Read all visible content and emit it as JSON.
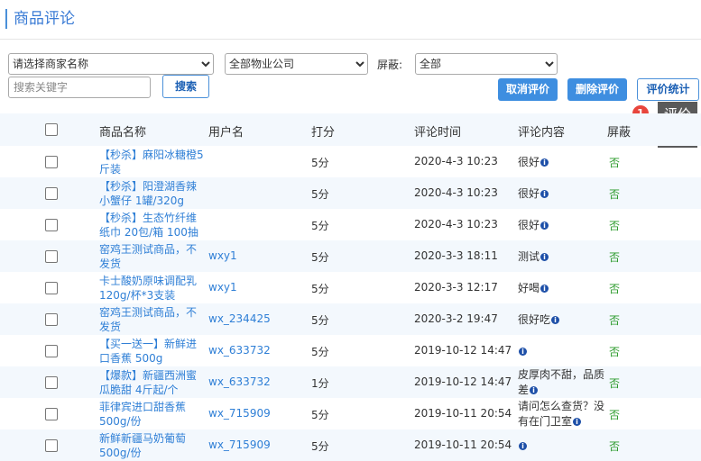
{
  "page": {
    "title": "商品评论"
  },
  "filters": {
    "merchant_selected": "请选择商家名称",
    "company_selected": "全部物业公司",
    "shield_label": "屏蔽:",
    "shield_selected": "全部",
    "search_placeholder": "搜索关键字",
    "search_button": "搜索"
  },
  "actions": {
    "cancel_review": "取消评价",
    "delete_review": "删除评价",
    "review_stats": "评价统计"
  },
  "tooltip": {
    "badge": "1",
    "text": "评价统计"
  },
  "table": {
    "headers": [
      "商品名称",
      "用户名",
      "打分",
      "评论时间",
      "评论内容",
      "屏蔽"
    ],
    "rows": [
      {
        "product": "【秒杀】麻阳冰糖橙5斤装",
        "user": "",
        "score": "5分",
        "time": "2020-4-3 10:23",
        "comment": "很好",
        "shielded": "否"
      },
      {
        "product": "【秒杀】阳澄湖香辣小蟹仔 1罐/320g",
        "user": "",
        "score": "5分",
        "time": "2020-4-3 10:23",
        "comment": "很好",
        "shielded": "否"
      },
      {
        "product": "【秒杀】生态竹纤维纸巾 20包/箱 100抽",
        "user": "",
        "score": "5分",
        "time": "2020-4-3 10:23",
        "comment": "很好",
        "shielded": "否"
      },
      {
        "product": "窑鸡王测试商品，不发货",
        "user": "wxy1",
        "score": "5分",
        "time": "2020-3-3 18:11",
        "comment": "测试",
        "shielded": "否"
      },
      {
        "product": "卡士酸奶原味调配乳120g/杯*3支装",
        "user": "wxy1",
        "score": "5分",
        "time": "2020-3-3 12:17",
        "comment": "好喝",
        "shielded": "否"
      },
      {
        "product": "窑鸡王测试商品，不发货",
        "user": "wx_234425",
        "score": "5分",
        "time": "2020-3-2 19:47",
        "comment": "很好吃",
        "shielded": "否"
      },
      {
        "product": "【买一送一】新鲜进口香蕉 500g",
        "user": "wx_633732",
        "score": "5分",
        "time": "2019-10-12 14:47",
        "comment": "",
        "shielded": "否"
      },
      {
        "product": "【爆款】新疆西洲蜜瓜脆甜 4斤起/个",
        "user": "wx_633732",
        "score": "1分",
        "time": "2019-10-12 14:47",
        "comment": "皮厚肉不甜，品质差",
        "shielded": "否"
      },
      {
        "product": "菲律宾进口甜香蕉 500g/份",
        "user": "wx_715909",
        "score": "5分",
        "time": "2019-10-11 20:54",
        "comment": "请问怎么查货？没有在门卫室",
        "shielded": "否"
      },
      {
        "product": "新鲜新疆马奶葡萄 500g/份",
        "user": "wx_715909",
        "score": "5分",
        "time": "2019-10-11 20:54",
        "comment": "",
        "shielded": "否"
      }
    ]
  },
  "icons": {
    "info": "info-icon"
  },
  "colors": {
    "accent": "#3e8ee0",
    "link": "#2f7fd6",
    "shield_no": "#2a9a2a",
    "header_bg": "#f3f8fd",
    "badge": "#e8453c"
  }
}
